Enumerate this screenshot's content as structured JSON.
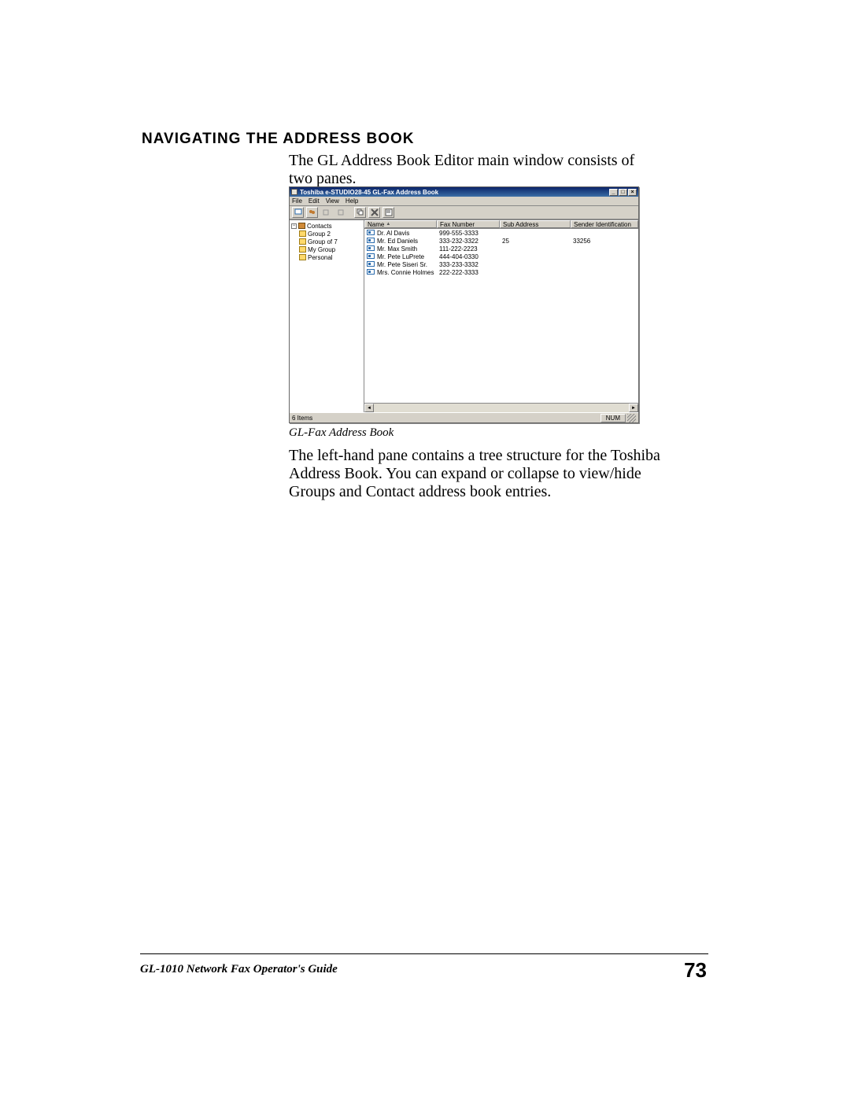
{
  "heading": "Navigating the Address Book",
  "para1": "The GL Address Book Editor main window consists of two panes.",
  "caption": "GL-Fax Address Book",
  "para2": "The left-hand pane contains a tree structure for the Toshiba Address Book. You can expand or collapse to view/hide Groups and Contact address book entries.",
  "footer_left": "GL-1010 Network Fax Operator's Guide",
  "footer_page": "73",
  "window": {
    "title": "Toshiba e-STUDIO28-45 GL-Fax Address Book",
    "menus": [
      "File",
      "Edit",
      "View",
      "Help"
    ],
    "tree_root": "Contacts",
    "tree_items": [
      "Group 2",
      "Group of 7",
      "My Group",
      "Personal"
    ],
    "columns": [
      "Name",
      "Fax Number",
      "Sub Address",
      "Sender Identification"
    ],
    "rows": [
      {
        "name": "Dr. Al Davis",
        "fax": "999-555-3333",
        "sub": "",
        "sid": ""
      },
      {
        "name": "Mr. Ed Daniels",
        "fax": "333-232-3322",
        "sub": "25",
        "sid": "33256"
      },
      {
        "name": "Mr. Max Smith",
        "fax": "111-222-2223",
        "sub": "",
        "sid": ""
      },
      {
        "name": "Mr. Pete LuPrete",
        "fax": "444-404-0330",
        "sub": "",
        "sid": ""
      },
      {
        "name": "Mr. Pete Siseri Sr.",
        "fax": "333-233-3332",
        "sub": "",
        "sid": ""
      },
      {
        "name": "Mrs. Connie Holmes",
        "fax": "222-222-3333",
        "sub": "",
        "sid": ""
      }
    ],
    "status_left": "6 Items",
    "status_right": "NUM"
  }
}
